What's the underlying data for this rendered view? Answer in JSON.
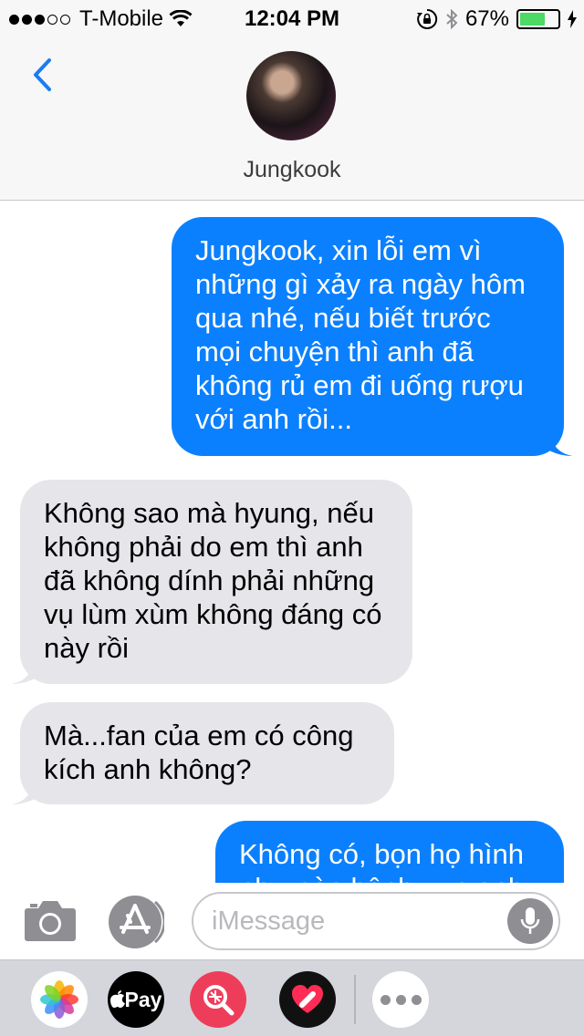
{
  "status_bar": {
    "signal_filled": 3,
    "signal_total": 5,
    "carrier": "T-Mobile",
    "time": "12:04 PM",
    "battery_text": "67%",
    "battery_level": 0.67,
    "icons": [
      "wifi-icon",
      "rotation-lock-icon",
      "bluetooth-icon",
      "battery-icon",
      "charging-bolt-icon"
    ]
  },
  "header": {
    "back_icon": "chevron-left-icon",
    "contact_name": "Jungkook"
  },
  "messages": [
    {
      "direction": "outgoing",
      "text": "Jungkook, xin lỗi em vì những gì xảy ra ngày hôm qua nhé, nếu biết trước mọi chuyện thì anh đã không rủ em đi uống rượu với anh rồi..."
    },
    {
      "direction": "incoming",
      "text": "Không sao mà hyung, nếu không phải do em thì anh đã không dính phải những vụ lùm xùm không đáng có này rồi"
    },
    {
      "direction": "incoming",
      "text": "Mà...fan của em có công kích anh không?"
    },
    {
      "direction": "outgoing",
      "text": "Không có, bọn họ hình như còn bênh vực anh"
    }
  ],
  "input_bar": {
    "placeholder": "iMessage",
    "value": "",
    "icons": [
      "camera-icon",
      "app-store-icon",
      "microphone-icon"
    ]
  },
  "app_drawer": {
    "apps": [
      {
        "icon": "photos-icon"
      },
      {
        "icon": "apple-pay-icon",
        "label": "Pay"
      },
      {
        "icon": "image-search-icon"
      },
      {
        "icon": "digital-touch-icon"
      },
      {
        "icon": "more-apps-icon"
      }
    ]
  },
  "colors": {
    "outgoing_bubble": "#0b80fe",
    "incoming_bubble": "#e5e5ea",
    "accent": "#1a7cf5",
    "battery_green": "#4cd964"
  }
}
